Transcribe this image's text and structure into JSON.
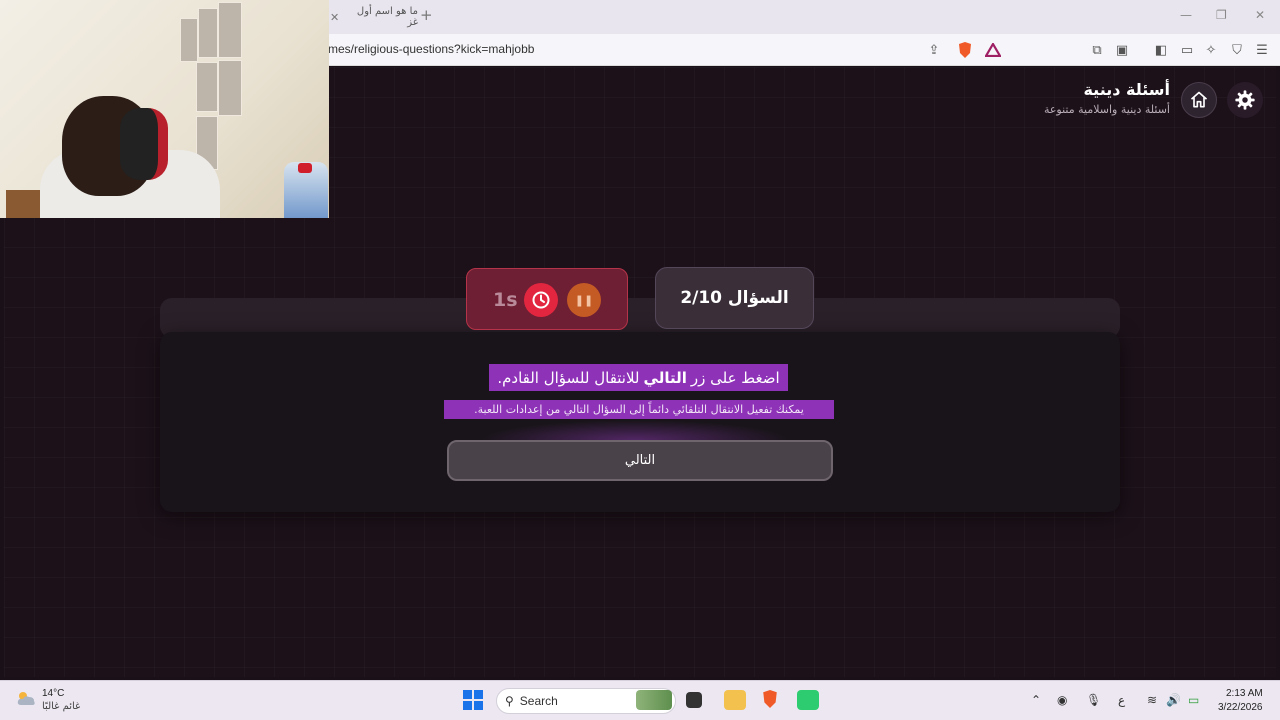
{
  "browser": {
    "tab_title": "ما هو اسم أول غز",
    "new_tab": "+",
    "url": "mes/religious-questions?kick=mahjobb"
  },
  "app": {
    "title": "أسئلة دينية",
    "subtitle": "أسئلة دينية واسلامية متنوعة"
  },
  "game": {
    "question_counter": "السؤال 2/10",
    "timer_value": "1s",
    "instruction_before": "اضغط على زر",
    "instruction_bold": "التالي",
    "instruction_after": "للانتقال للسؤال القادم.",
    "hint": "يمكنك تفعيل الانتقال التلقائي دائماً إلى السؤال التالي من إعدادات اللعبة.",
    "next_label": "التالي"
  },
  "taskbar": {
    "weather_temp": "14°C",
    "weather_desc": "غائم غالبًا",
    "search_label": "Search",
    "lang": "ع",
    "time": "2:13 AM",
    "date": "3/22/2026"
  },
  "colors": {
    "accent_purple": "#8e32b8",
    "timer_red": "#e2263f",
    "app_bg": "#1c1119"
  }
}
